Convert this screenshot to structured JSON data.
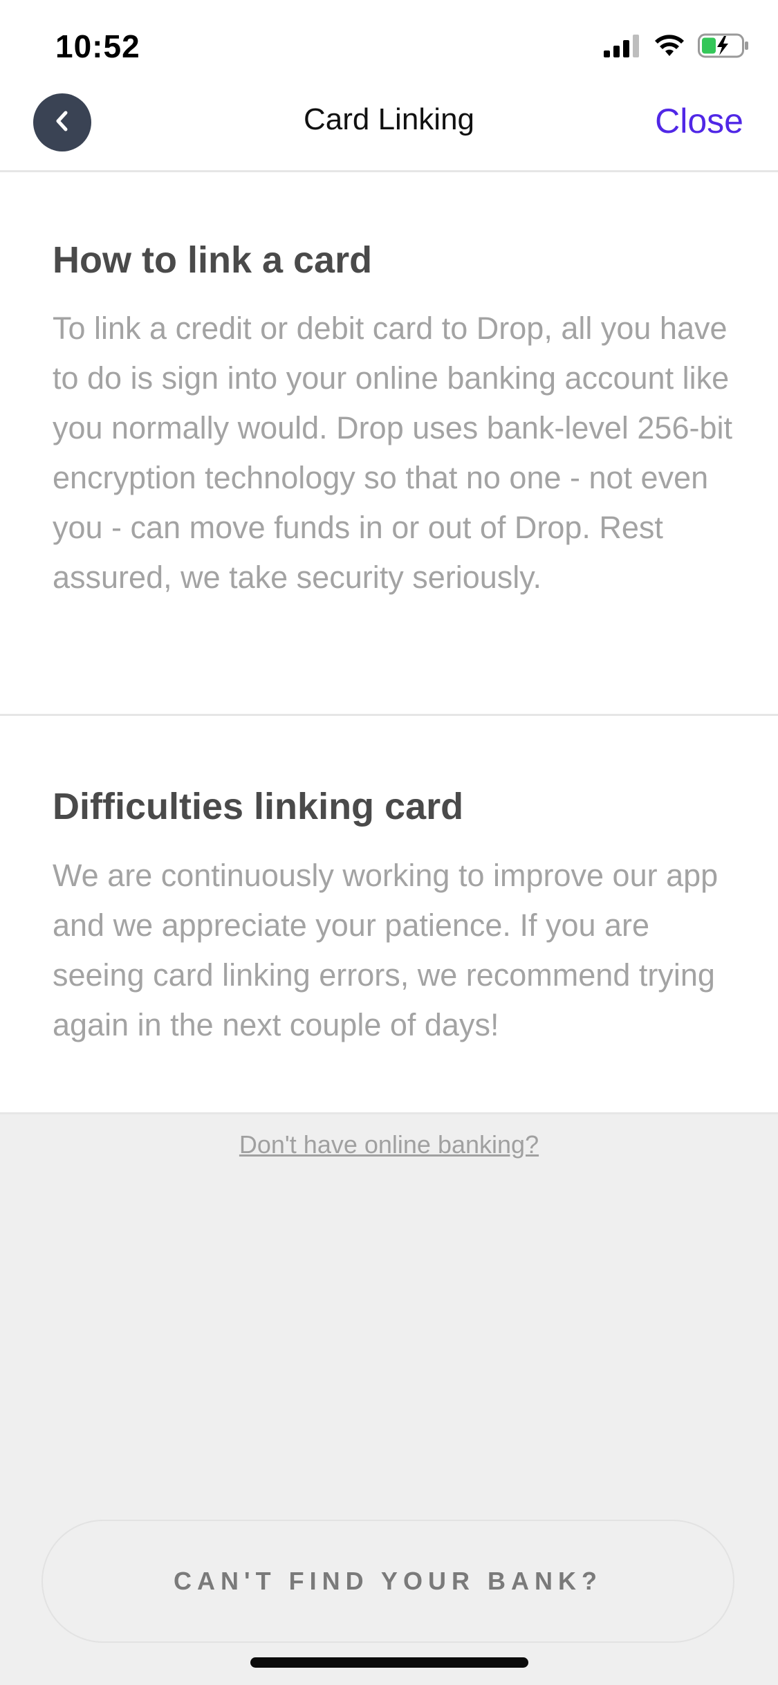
{
  "status_bar": {
    "time": "10:52",
    "icons": [
      "cellular-signal-icon",
      "wifi-icon",
      "battery-charging-icon"
    ]
  },
  "nav": {
    "back_icon": "chevron-left-icon",
    "title": "Card Linking",
    "close_label": "Close"
  },
  "sections": [
    {
      "heading": "How to link a card",
      "body": "To link a credit or debit card to Drop, all you have to do is sign into your online banking account like you normally would. Drop uses bank-level 256-bit encryption technology so that no one - not even you - can move funds in or out of Drop. Rest assured, we take security seriously."
    },
    {
      "heading": "Difficulties linking card",
      "body": "We are continuously working to improve our app and we appreciate your patience. If you are seeing card linking errors, we recommend trying again in the next couple of days!"
    }
  ],
  "footer": {
    "no_banking_link": "Don't have online banking?",
    "cant_find_button": "CAN'T FIND YOUR BANK?"
  },
  "colors": {
    "accent": "#5027e6",
    "back_button_bg": "#3a4354",
    "heading": "#4a4a4a",
    "body_text": "#a3a3a3",
    "page_bg": "#efefef"
  }
}
